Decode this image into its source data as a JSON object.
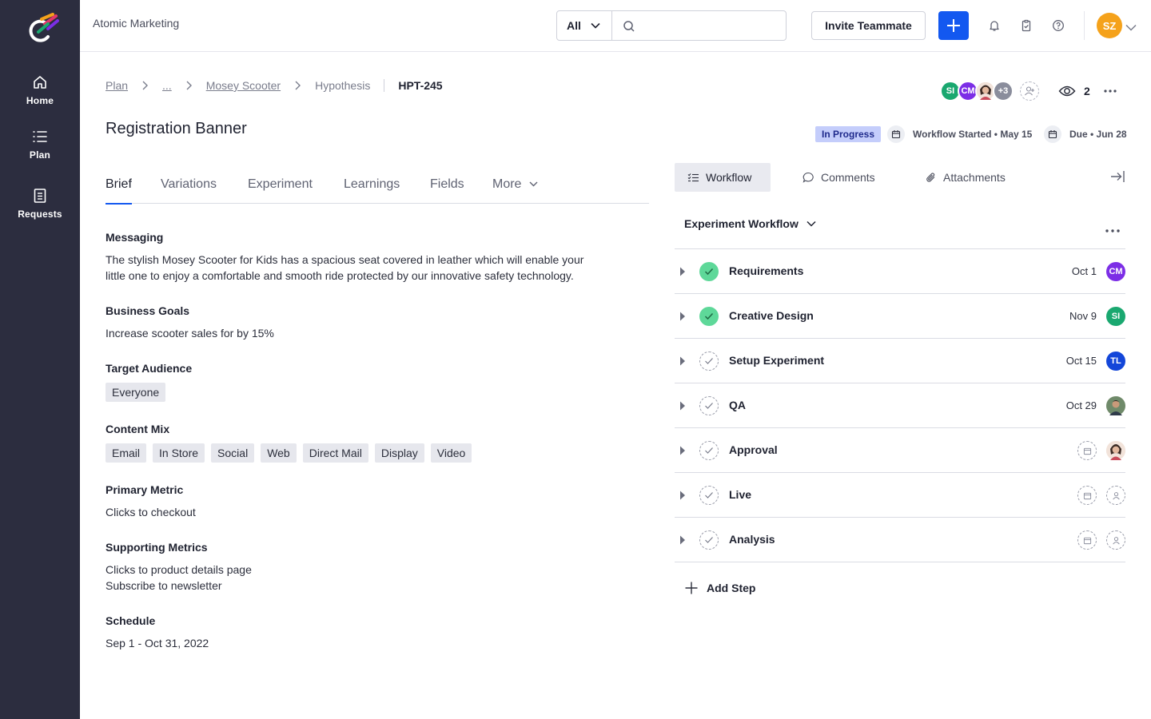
{
  "app": {
    "org_name": "Atomic Marketing",
    "accent_color": "#1358f0",
    "sidebar_color": "#2c2d3f"
  },
  "sidebar": {
    "items": [
      {
        "label": "Home",
        "icon": "home-icon"
      },
      {
        "label": "Plan",
        "icon": "list-icon"
      },
      {
        "label": "Requests",
        "icon": "document-icon"
      }
    ]
  },
  "topbar": {
    "scope_value": "All",
    "search_placeholder": "",
    "invite_label": "Invite Teammate",
    "user_initials": "SZ"
  },
  "breadcrumb": {
    "plan": "Plan",
    "ellipsis": "...",
    "project": "Mosey Scooter",
    "type": "Hypothesis",
    "id": "HPT-245"
  },
  "header": {
    "title": "Registration Banner",
    "status": "In Progress",
    "workflow_started": "Workflow Started • May 15",
    "due": "Due • Jun 28",
    "watchers_count": "2",
    "members": [
      {
        "initials": "SI",
        "color": "#1aa870"
      },
      {
        "initials": "CM",
        "color": "#7c2ee6"
      },
      {
        "initials": "",
        "color": "#d9b7a0"
      },
      {
        "initials": "+3",
        "color": "#8a8d9c"
      }
    ]
  },
  "tabs": [
    "Brief",
    "Variations",
    "Experiment",
    "Learnings",
    "Fields",
    "More"
  ],
  "brief": {
    "messaging_label": "Messaging",
    "messaging_line1": "The stylish Mosey Scooter for Kids has a spacious seat covered in leather which will enable your",
    "messaging_line2": "little one to enjoy a comfortable and smooth ride protected by our innovative safety technology.",
    "goals_label": "Business Goals",
    "goals": "Increase scooter sales for by 15%",
    "audience_label": "Target Audience",
    "audience": "Everyone",
    "content_mix_label": "Content Mix",
    "content_mix": [
      "Email",
      "In Store",
      "Social",
      "Web",
      "Direct Mail",
      "Display",
      "Video"
    ],
    "primary_metric_label": "Primary Metric",
    "primary_metric": "Clicks to checkout",
    "supporting_label": "Supporting Metrics",
    "supporting_1": "Clicks to product details page",
    "supporting_2": "Subscribe to newsletter",
    "schedule_label": "Schedule",
    "schedule": "Sep 1 - Oct 31, 2022"
  },
  "panel": {
    "tabs": [
      "Workflow",
      "Comments",
      "Attachments"
    ],
    "workflow_name": "Experiment Workflow",
    "add_step": "Add Step",
    "steps": [
      {
        "name": "Requirements",
        "date": "Oct 1",
        "done": true,
        "assignee": "CM",
        "assignee_color": "#7c2ee6"
      },
      {
        "name": "Creative Design",
        "date": "Nov 9",
        "done": true,
        "assignee": "SI",
        "assignee_color": "#1aa870"
      },
      {
        "name": "Setup Experiment",
        "date": "Oct 15",
        "done": false,
        "assignee": "TL",
        "assignee_color": "#1346d9"
      },
      {
        "name": "QA",
        "date": "Oct 29",
        "done": false,
        "assignee": "",
        "assignee_color": "#4f6a52"
      },
      {
        "name": "Approval",
        "date": "",
        "done": false,
        "assignee": "",
        "assignee_color": "#d9b7a0"
      },
      {
        "name": "Live",
        "date": "",
        "done": false,
        "assignee": "",
        "assignee_color": ""
      },
      {
        "name": "Analysis",
        "date": "",
        "done": false,
        "assignee": "",
        "assignee_color": ""
      }
    ]
  }
}
